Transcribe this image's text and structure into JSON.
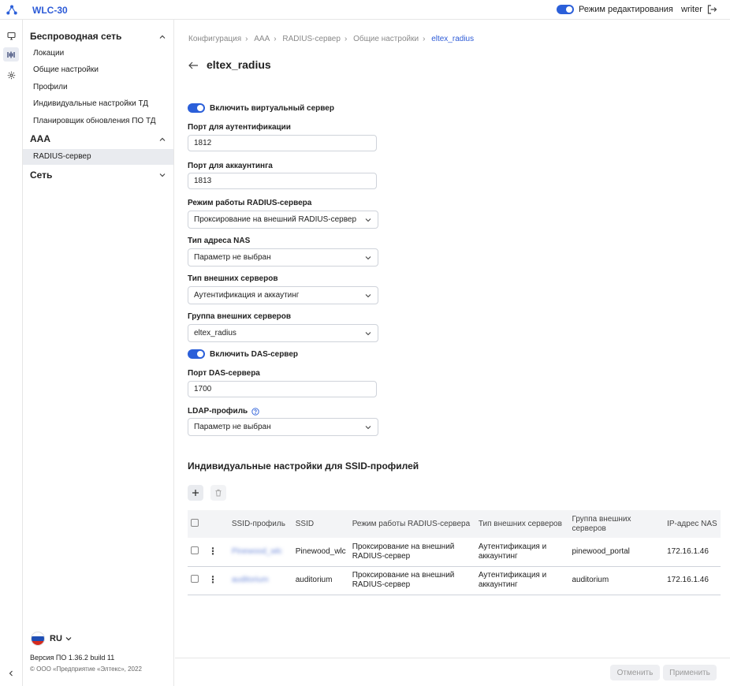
{
  "app": {
    "title": "WLC-30",
    "edit_mode_label": "Режим редактирования",
    "username": "writer"
  },
  "sidebar": {
    "sections": [
      {
        "title": "Беспроводная сеть",
        "items": [
          "Локации",
          "Общие настройки",
          "Профили",
          "Индивидуальные настройки ТД",
          "Планировщик обновления ПО ТД"
        ]
      },
      {
        "title": "AAA",
        "items": [
          "RADIUS-сервер"
        ]
      },
      {
        "title": "Сеть",
        "items": []
      }
    ],
    "language": "RU",
    "version": "Версия ПО 1.36.2 build 11",
    "copyright": "© ООО «Предприятие «Элтекс», 2022"
  },
  "breadcrumb": [
    "Конфигурация",
    "AAA",
    "RADIUS-сервер",
    "Общие настройки",
    "eltex_radius"
  ],
  "page": {
    "title": "eltex_radius"
  },
  "form": {
    "virtual_server": {
      "label": "Включить виртуальный сервер",
      "enabled": true
    },
    "auth_port": {
      "label": "Порт для аутентификации",
      "value": "1812"
    },
    "acct_port": {
      "label": "Порт для аккаунтинга",
      "value": "1813"
    },
    "radius_mode": {
      "label": "Режим работы RADIUS-сервера",
      "value": "Проксирование на внешний RADIUS-сервер"
    },
    "nas_type": {
      "label": "Тип адреса NAS",
      "value": "Параметр не выбран"
    },
    "ext_type": {
      "label": "Тип внешних серверов",
      "value": "Аутентификация и аккаутинг"
    },
    "ext_group": {
      "label": "Группа внешних серверов",
      "value": "eltex_radius"
    },
    "das": {
      "label": "Включить DAS-сервер",
      "enabled": true
    },
    "das_port": {
      "label": "Порт DAS-сервера",
      "value": "1700"
    },
    "ldap": {
      "label": "LDAP-профиль",
      "value": "Параметр не выбран"
    }
  },
  "ssid_section": {
    "title": "Индивидуальные настройки для SSID-профилей",
    "columns": [
      "SSID-профиль",
      "SSID",
      "Режим работы RADIUS-сервера",
      "Тип внешних серверов",
      "Группа внешних серверов",
      "IP-адрес NAS"
    ],
    "rows": [
      {
        "profile": "Pinewood_wlc",
        "ssid": "Pinewood_wlc",
        "mode": "Проксирование на внешний RADIUS-сервер",
        "ext_type": "Аутентификация и аккаунтинг",
        "group": "pinewood_portal",
        "ip": "172.16.1.46"
      },
      {
        "profile": "auditorium",
        "ssid": "auditorium",
        "mode": "Проксирование на внешний RADIUS-сервер",
        "ext_type": "Аутентификация и аккаунтинг",
        "group": "auditorium",
        "ip": "172.16.1.46"
      }
    ]
  },
  "footer": {
    "cancel": "Отменить",
    "apply": "Применить"
  },
  "colors": {
    "accent": "#2b5fd9"
  }
}
